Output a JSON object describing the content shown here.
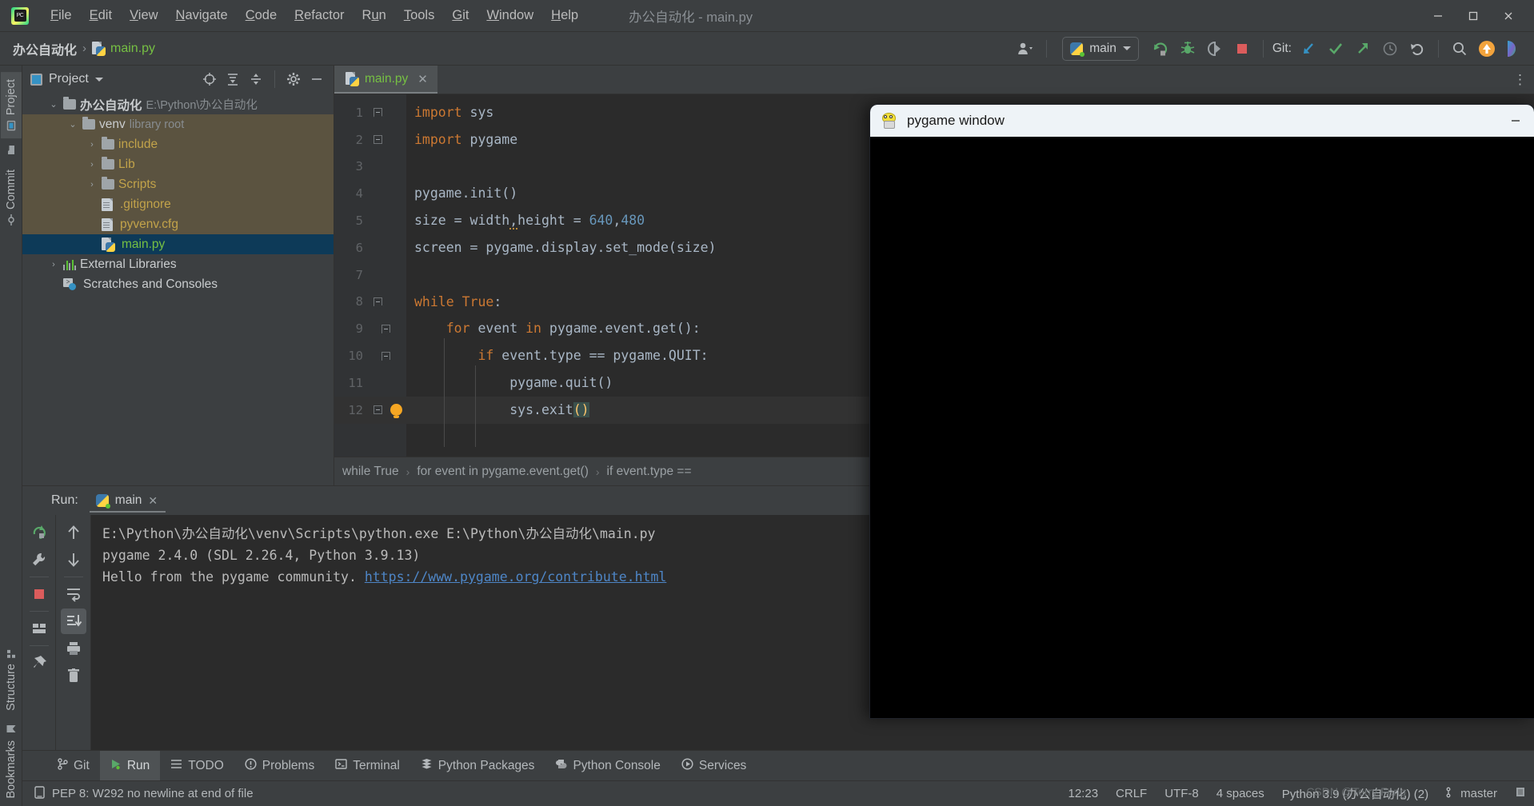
{
  "window": {
    "title": "办公自动化 - main.py",
    "app_icon": "pycharm-logo-icon",
    "minimize": "minimize-icon",
    "maximize": "maximize-icon",
    "close": "close-icon"
  },
  "menu": [
    {
      "label": "File",
      "accel": "F"
    },
    {
      "label": "Edit",
      "accel": "E"
    },
    {
      "label": "View",
      "accel": "V"
    },
    {
      "label": "Navigate",
      "accel": "N"
    },
    {
      "label": "Code",
      "accel": "C"
    },
    {
      "label": "Refactor",
      "accel": "R"
    },
    {
      "label": "Run",
      "accel": "u"
    },
    {
      "label": "Tools",
      "accel": "T"
    },
    {
      "label": "Git",
      "accel": "G"
    },
    {
      "label": "Window",
      "accel": "W"
    },
    {
      "label": "Help",
      "accel": "H"
    }
  ],
  "toolbar": {
    "breadcrumb_project": "办公自动化",
    "breadcrumb_sep": "›",
    "breadcrumb_file": "main.py",
    "account_icon": "user-account-icon",
    "run_config": "main",
    "run_icon": "run-icon",
    "debug_icon": "debug-icon",
    "coverage_icon": "run-with-coverage-icon",
    "stop_icon": "stop-icon",
    "git_label": "Git:",
    "git_update_icon": "git-update-project-icon",
    "git_commit_icon": "git-commit-icon",
    "git_push_icon": "git-push-icon",
    "history_icon": "history-icon",
    "undo_icon": "undo-icon",
    "search_icon": "search-everywhere-icon",
    "updates_icon": "ide-update-icon",
    "feature_icon": "feature-trainer-icon"
  },
  "left_strip": [
    {
      "label": "Project",
      "icon": "project-icon",
      "active": true
    },
    {
      "label": "Commit",
      "icon": "commit-icon",
      "active": false
    }
  ],
  "left_strip_bottom": [
    {
      "label": "Structure",
      "icon": "structure-icon"
    },
    {
      "label": "Bookmarks",
      "icon": "bookmarks-icon"
    }
  ],
  "project_panel": {
    "title": "Project",
    "dropdown_icon": "chevron-down-icon",
    "icons": [
      "select-opened-file-icon",
      "expand-all-icon",
      "collapse-all-icon",
      "settings-gear-icon",
      "hide-panel-icon"
    ],
    "tree": [
      {
        "depth": 0,
        "arrow": "⌄",
        "icon": "folder",
        "name": "办公自动化",
        "bold": true,
        "hint": "E:\\Python\\办公自动化",
        "state": "open",
        "highlight": "none"
      },
      {
        "depth": 1,
        "arrow": "⌄",
        "icon": "folder",
        "name": "venv",
        "bold": false,
        "hint": "library root",
        "state": "open",
        "highlight": "lib"
      },
      {
        "depth": 2,
        "arrow": "›",
        "icon": "folder",
        "name": "include",
        "color": "yellow",
        "state": "closed",
        "highlight": "lib"
      },
      {
        "depth": 2,
        "arrow": "›",
        "icon": "folder",
        "name": "Lib",
        "color": "yellow",
        "state": "closed",
        "highlight": "lib"
      },
      {
        "depth": 2,
        "arrow": "›",
        "icon": "folder",
        "name": "Scripts",
        "color": "yellow",
        "state": "closed",
        "highlight": "lib"
      },
      {
        "depth": 2,
        "arrow": "",
        "icon": "gitignore-file",
        "name": ".gitignore",
        "color": "yellow",
        "highlight": "lib"
      },
      {
        "depth": 2,
        "arrow": "",
        "icon": "cfg-file",
        "name": "pyvenv.cfg",
        "color": "yellow",
        "highlight": "lib"
      },
      {
        "depth": 1,
        "arrow": "",
        "icon": "python-file",
        "name": "main.py",
        "color": "green",
        "highlight": "selected"
      },
      {
        "depth": 0,
        "arrow": "›",
        "icon": "external-libraries",
        "name": "External Libraries",
        "highlight": "none"
      },
      {
        "depth": 0,
        "arrow": "",
        "icon": "scratches",
        "name": "Scratches and Consoles",
        "highlight": "none"
      }
    ]
  },
  "editor": {
    "tab": {
      "label": "main.py",
      "icon": "python-file-icon",
      "close": "close-tab-icon"
    },
    "more_icon": "more-options-icon",
    "lines": [
      {
        "no": "1",
        "fold": "start",
        "bulb": false,
        "text": "import sys"
      },
      {
        "no": "2",
        "fold": "end",
        "bulb": false,
        "text": "import pygame"
      },
      {
        "no": "3",
        "fold": "none",
        "bulb": false,
        "text": ""
      },
      {
        "no": "4",
        "fold": "none",
        "bulb": false,
        "text": "pygame.init()"
      },
      {
        "no": "5",
        "fold": "none",
        "bulb": false,
        "text": "size = width,height = 640,480"
      },
      {
        "no": "6",
        "fold": "none",
        "bulb": false,
        "text": "screen = pygame.display.set_mode(size)"
      },
      {
        "no": "7",
        "fold": "none",
        "bulb": false,
        "text": ""
      },
      {
        "no": "8",
        "fold": "start",
        "bulb": false,
        "text": "while True:"
      },
      {
        "no": "9",
        "fold": "start",
        "bulb": false,
        "text": "    for event in pygame.event.get():"
      },
      {
        "no": "10",
        "fold": "start",
        "bulb": false,
        "text": "        if event.type == pygame.QUIT:"
      },
      {
        "no": "11",
        "fold": "none",
        "bulb": false,
        "text": "            pygame.quit()"
      },
      {
        "no": "12",
        "fold": "end",
        "bulb": true,
        "text": "            sys.exit()"
      }
    ],
    "breadcrumbs": [
      "while True",
      "for event in pygame.event.get()",
      "if event.type =="
    ]
  },
  "run_panel": {
    "label": "Run:",
    "tab": "main",
    "tab_icon": "python-run-config-icon",
    "tab_close": "close-icon",
    "tools_left": [
      "rerun-icon",
      "settings-wrench-icon",
      "stop-icon",
      "layout-icon",
      "pin-tab-icon"
    ],
    "tools_right": [
      "up-arrow-icon",
      "down-arrow-icon",
      "soft-wrap-icon",
      "scroll-to-end-icon",
      "print-icon",
      "clear-all-icon"
    ],
    "console": [
      {
        "text": "E:\\Python\\办公自动化\\venv\\Scripts\\python.exe E:\\Python\\办公自动化\\main.py",
        "link": ""
      },
      {
        "text": "pygame 2.4.0 (SDL 2.26.4, Python 3.9.13)",
        "link": ""
      },
      {
        "text": "Hello from the pygame community. ",
        "link": "https://www.pygame.org/contribute.html"
      }
    ]
  },
  "bottom_tabs": [
    {
      "label": "Git",
      "icon": "git-branch-icon",
      "active": false
    },
    {
      "label": "Run",
      "icon": "run-triangle-icon",
      "active": true
    },
    {
      "label": "TODO",
      "icon": "todo-list-icon",
      "active": false
    },
    {
      "label": "Problems",
      "icon": "problems-icon",
      "active": false
    },
    {
      "label": "Terminal",
      "icon": "terminal-icon",
      "active": false
    },
    {
      "label": "Python Packages",
      "icon": "python-packages-icon",
      "active": false
    },
    {
      "label": "Python Console",
      "icon": "python-console-icon",
      "active": false
    },
    {
      "label": "Services",
      "icon": "services-icon",
      "active": false
    }
  ],
  "status_bar": {
    "inspection_icon": "inspection-widget-icon",
    "message": "PEP 8: W292 no newline at end of file",
    "caret": "12:23",
    "line_sep": "CRLF",
    "encoding": "UTF-8",
    "indent": "4 spaces",
    "interpreter": "Python 3.9 (办公自动化) (2)",
    "branch_icon": "git-branch-icon",
    "branch": "master",
    "memory_icon": "memory-indicator-icon",
    "watermark": "CSDN @Terry Feng"
  },
  "pygame_window": {
    "title": "pygame window",
    "icon": "pygame-mascot-icon",
    "minimize": "minimize-icon",
    "canvas_color": "#000000"
  },
  "colors": {
    "ide_bg": "#3c3f41",
    "editor_bg": "#2b2b2b",
    "selection_blue": "#0d3a58",
    "lib_highlight": "#5b5340",
    "green_text": "#76c043",
    "yellow_text": "#c2a34a",
    "keyword_orange": "#cc7832",
    "number_blue": "#6897bb",
    "link_blue": "#4e86c7"
  }
}
